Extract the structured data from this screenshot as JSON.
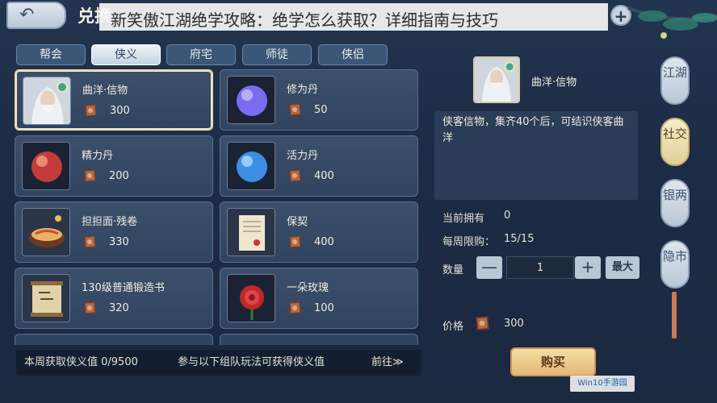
{
  "banner": {
    "title": "新笑傲江湖绝学攻略：绝学怎么获取？详细指南与技巧"
  },
  "header": {
    "title_partial": "兑换"
  },
  "tabs": [
    {
      "label": "帮会",
      "active": false
    },
    {
      "label": "侠义",
      "active": true
    },
    {
      "label": "府宅",
      "active": false
    },
    {
      "label": "师徒",
      "active": false
    },
    {
      "label": "侠侣",
      "active": false
    }
  ],
  "items": [
    {
      "name": "曲洋·信物",
      "price": "300",
      "icon": "elder-portrait-icon",
      "selected": true
    },
    {
      "name": "修为丹",
      "price": "50",
      "icon": "purple-orb-icon"
    },
    {
      "name": "精力丹",
      "price": "200",
      "icon": "red-orb-icon"
    },
    {
      "name": "活力丹",
      "price": "400",
      "icon": "blue-orb-icon"
    },
    {
      "name": "担担面·残卷",
      "price": "330",
      "icon": "noodle-bowl-icon"
    },
    {
      "name": "保契",
      "price": "400",
      "icon": "contract-scroll-icon"
    },
    {
      "name": "130级普通锻造书",
      "price": "320",
      "icon": "scroll-book-icon"
    },
    {
      "name": "一朵玫瑰",
      "price": "100",
      "icon": "rose-icon"
    }
  ],
  "info_bar": {
    "weekly": "本周获取侠义值 0/9500",
    "hint": "参与以下组队玩法可获得侠义值",
    "goto": "前往≫"
  },
  "detail": {
    "name": "曲洋·信物",
    "description": "侠客信物，集齐40个后，可结识侠客曲洋",
    "owned_label": "当前拥有",
    "owned_value": "0",
    "limit_label": "每周限购：",
    "limit_value": "15/15",
    "qty_label": "数量",
    "qty_value": "1",
    "minus": "—",
    "plus": "+",
    "max": "最大",
    "price_label": "价格",
    "price_value": "300",
    "buy": "购买"
  },
  "side_nav": [
    {
      "label": "江湖",
      "active": false
    },
    {
      "label": "社交",
      "active": true
    },
    {
      "label": "银两",
      "active": false
    },
    {
      "label": "隐市",
      "active": false
    }
  ],
  "watermark": "Win10手游园",
  "colors": {
    "accent": "#e6dcae",
    "panel": "#31445f",
    "buy": "#e4b878"
  }
}
